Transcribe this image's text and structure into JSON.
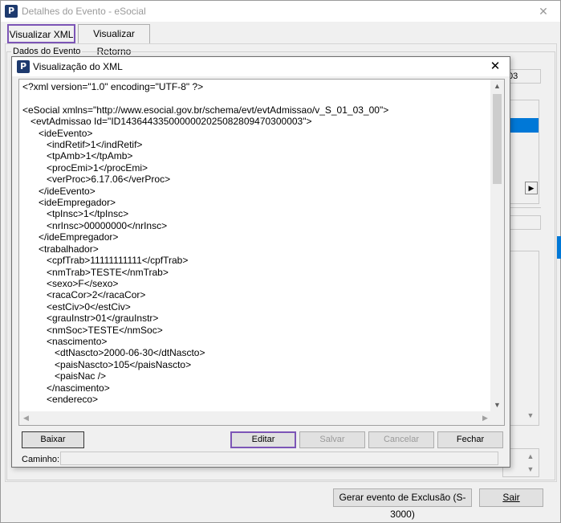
{
  "window": {
    "title": "Detalhes do Evento - eSocial",
    "close_glyph": "✕",
    "app_icon_letter": "P"
  },
  "tabs": [
    {
      "label": "Visualizar XML"
    },
    {
      "label": "Visualizar Retorno"
    }
  ],
  "group": {
    "label": "Dados do Evento"
  },
  "background": {
    "field_value": "03",
    "arrow_right": "▶",
    "scroll_down": "▼",
    "scroll_up_small": "▲"
  },
  "buttons": {
    "gerar_exclusao": "Gerar evento de Exclusão (S-3000)",
    "sair": "Sair"
  },
  "dialog": {
    "title": "Visualização do XML",
    "close_glyph": "✕",
    "xml_lines": [
      "<?xml version=\"1.0\" encoding=\"UTF-8\" ?>",
      "",
      "<eSocial xmlns=\"http://www.esocial.gov.br/schema/evt/evtAdmissao/v_S_01_03_00\">",
      "   <evtAdmissao Id=\"ID1436443350000002025082809470300003\">",
      "      <ideEvento>",
      "         <indRetif>1</indRetif>",
      "         <tpAmb>1</tpAmb>",
      "         <procEmi>1</procEmi>",
      "         <verProc>6.17.06</verProc>",
      "      </ideEvento>",
      "      <ideEmpregador>",
      "         <tpInsc>1</tpInsc>",
      "         <nrInsc>00000000</nrInsc>",
      "      </ideEmpregador>",
      "      <trabalhador>",
      "         <cpfTrab>11111111111</cpfTrab>",
      "         <nmTrab>TESTE</nmTrab>",
      "         <sexo>F</sexo>",
      "         <racaCor>2</racaCor>",
      "         <estCiv>0</estCiv>",
      "         <grauInstr>01</grauInstr>",
      "         <nmSoc>TESTE</nmSoc>",
      "         <nascimento>",
      "            <dtNascto>2000-06-30</dtNascto>",
      "            <paisNascto>105</paisNascto>",
      "            <paisNac />",
      "         </nascimento>",
      "         <endereco>"
    ],
    "scroll": {
      "up": "▲",
      "down": "▼",
      "left": "◀",
      "right": "▶"
    },
    "buttons": {
      "baixar": "Baixar",
      "editar": "Editar",
      "salvar": "Salvar",
      "cancelar": "Cancelar",
      "fechar": "Fechar"
    },
    "caminho_label": "Caminho:",
    "caminho_value": ""
  },
  "colors": {
    "highlight": "#7c55b6",
    "selection": "#0078d7",
    "app_icon_bg": "#1e3a6e"
  }
}
